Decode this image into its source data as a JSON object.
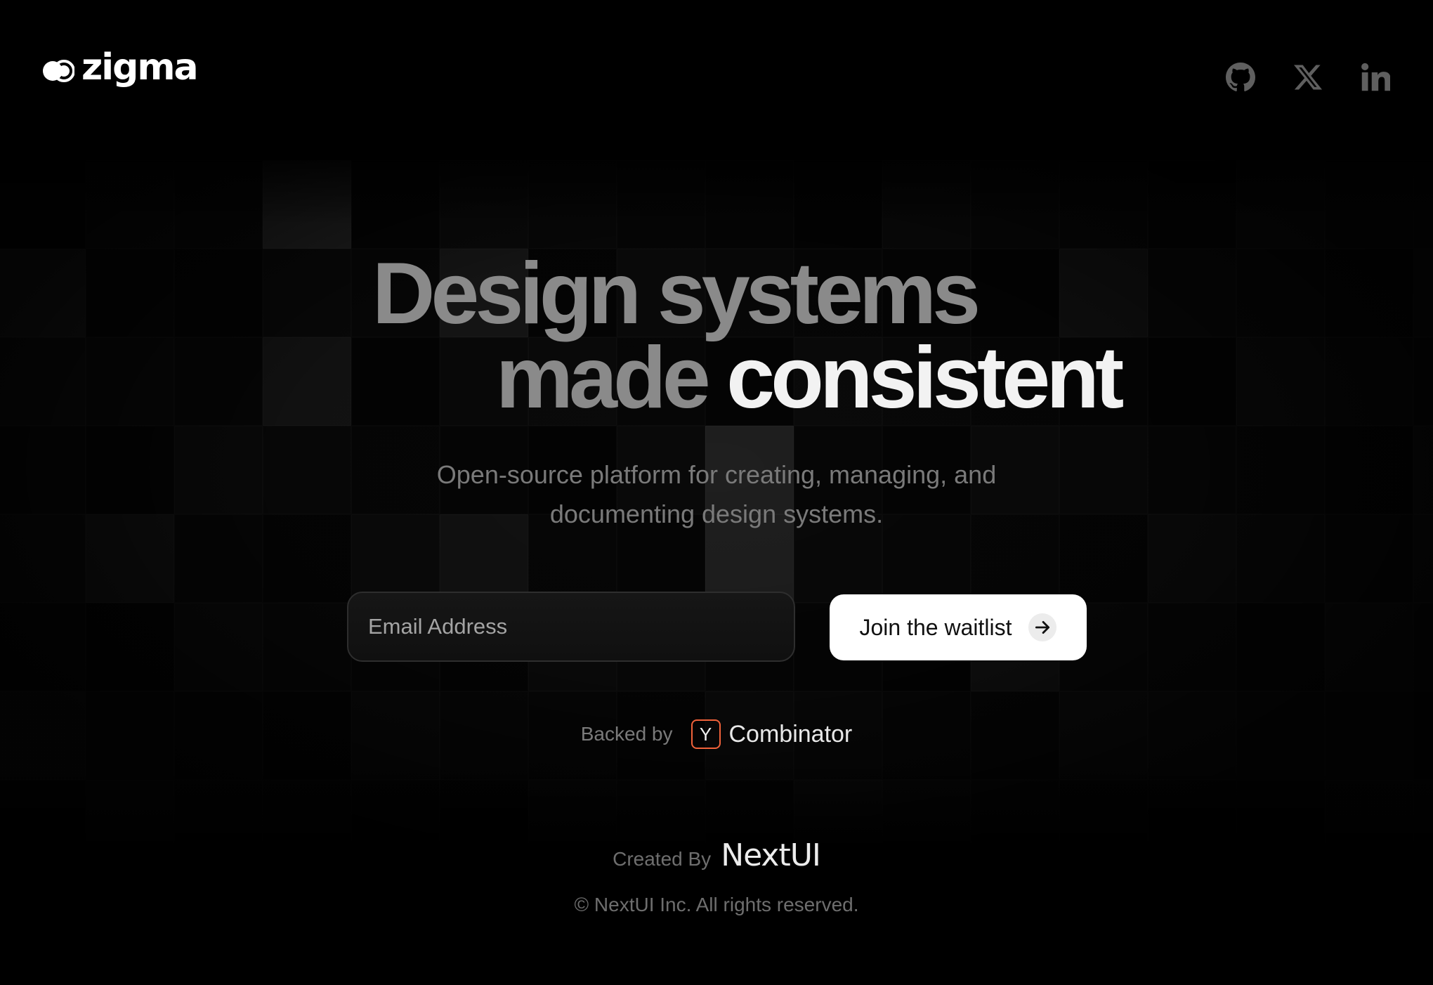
{
  "brand": {
    "name": "zigma",
    "logo_icon": "zigma-logo-icon"
  },
  "social": {
    "github_icon": "github-icon",
    "x_icon": "x-icon",
    "linkedin_icon": "linkedin-icon"
  },
  "hero": {
    "line1": "Design systems",
    "line2_muted": "made",
    "line2_bright": "consistent",
    "subtitle_line1": "Open-source platform for creating, managing, and",
    "subtitle_line2": "documenting design systems."
  },
  "form": {
    "email_placeholder": "Email Address",
    "email_value": "",
    "cta_label": "Join the waitlist",
    "cta_icon": "arrow-right-icon"
  },
  "backed": {
    "label": "Backed by",
    "yc_letter": "Y",
    "yc_name": "Combinator",
    "yc_color": "#f0623a"
  },
  "footer": {
    "created_label": "Created By",
    "created_brand": "NextUI",
    "copyright": "© NextUI Inc. All rights reserved."
  },
  "colors": {
    "background": "#000000",
    "muted_text": "#8a8a8a",
    "bright_text": "#f2f2f2",
    "cta_bg": "#ffffff"
  }
}
